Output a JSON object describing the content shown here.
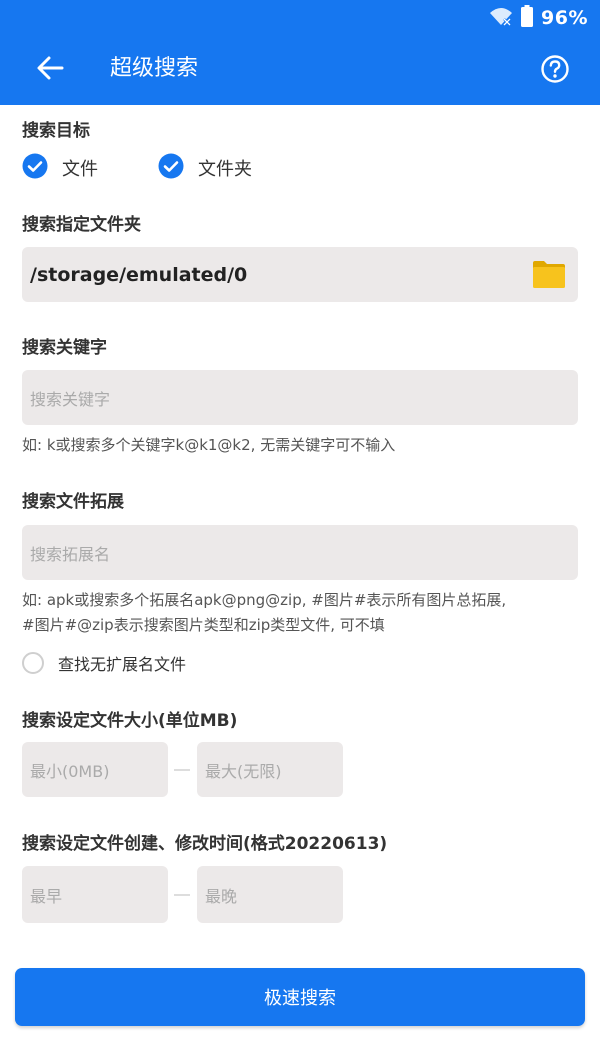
{
  "status_bar": {
    "battery": "96%"
  },
  "app_bar": {
    "title": "超级搜索"
  },
  "target": {
    "label": "搜索目标",
    "options": [
      {
        "label": "文件",
        "checked": true
      },
      {
        "label": "文件夹",
        "checked": true
      }
    ]
  },
  "folder": {
    "label": "搜索指定文件夹",
    "value": "/storage/emulated/0"
  },
  "keyword": {
    "label": "搜索关键字",
    "placeholder": "搜索关键字",
    "hint": "如: k或搜索多个关键字k@k1@k2, 无需关键字可不输入"
  },
  "extension": {
    "label": "搜索文件拓展",
    "placeholder": "搜索拓展名",
    "hint_line1": "如: apk或搜索多个拓展名apk@png@zip, #图片#表示所有图片总拓展,",
    "hint_line2": "#图片#@zip表示搜索图片类型和zip类型文件, 可不填",
    "no_ext_label": "查找无扩展名文件",
    "no_ext_checked": false
  },
  "size": {
    "label": "搜索设定文件大小(单位MB)",
    "min_placeholder": "最小(0MB)",
    "max_placeholder": "最大(无限)"
  },
  "time": {
    "label": "搜索设定文件创建、修改时间(格式20220613)",
    "earliest_placeholder": "最早",
    "latest_placeholder": "最晚"
  },
  "button": {
    "label": "极速搜索"
  },
  "colors": {
    "primary": "#1677f0",
    "field_bg": "#ece9e9",
    "folder_icon": "#f7c31d"
  }
}
